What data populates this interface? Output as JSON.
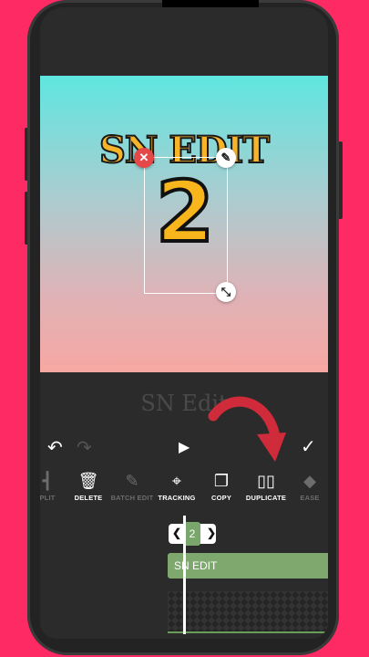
{
  "preview": {
    "title_text": "SN EDIT",
    "big_number": "2"
  },
  "caption": "SN Edit",
  "controls": {
    "undo_icon": "undo-icon",
    "redo_icon": "redo-icon",
    "play_icon": "play-icon",
    "confirm_icon": "check-icon"
  },
  "toolbar": {
    "items": [
      {
        "label": "PLIT",
        "icon": "split-icon",
        "enabled": false
      },
      {
        "label": "DELETE",
        "icon": "trash-icon",
        "enabled": true
      },
      {
        "label": "BATCH EDIT",
        "icon": "batch-edit-icon",
        "enabled": false
      },
      {
        "label": "TRACKING",
        "icon": "tracking-icon",
        "enabled": true
      },
      {
        "label": "COPY",
        "icon": "copy-icon",
        "enabled": true
      },
      {
        "label": "DUPLICATE",
        "icon": "duplicate-icon",
        "enabled": true
      },
      {
        "label": "EASE",
        "icon": "ease-icon",
        "enabled": false
      }
    ]
  },
  "timeline": {
    "keyframe_label": "2",
    "track_label": "SN EDIT"
  },
  "colors": {
    "background": "#fe2a63",
    "accent_green": "#7ea86d",
    "arrow_red": "#cf2b3a"
  }
}
